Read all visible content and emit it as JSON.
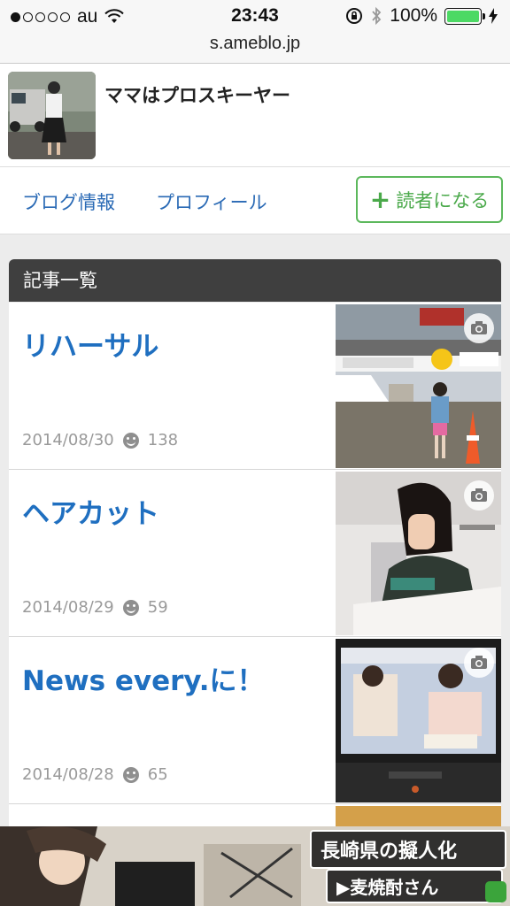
{
  "status": {
    "carrier": "au",
    "time": "23:43",
    "battery_text": "100%",
    "battery_level": 1.0,
    "signal_bars_filled": 1,
    "signal_bars_total": 5
  },
  "browser": {
    "url": "s.ameblo.jp"
  },
  "blog": {
    "title": "ママはプロスキーヤー",
    "nav": {
      "info": "ブログ情報",
      "profile": "プロフィール"
    },
    "follow_button": "読者になる"
  },
  "entries_section": {
    "heading": "記事一覧",
    "entries": [
      {
        "title": "リハーサル",
        "date": "2014/08/30",
        "count": "138"
      },
      {
        "title": "ヘアカット",
        "date": "2014/08/29",
        "count": "59"
      },
      {
        "title": "News every.に！",
        "date": "2014/08/28",
        "count": "65"
      }
    ]
  },
  "ad": {
    "line1": "長崎県の擬人化",
    "line2": "▶麦焼酎さん"
  },
  "colors": {
    "link": "#1f6fc0",
    "accent_green": "#5cb85c",
    "section_bar": "#3f3f3f"
  }
}
